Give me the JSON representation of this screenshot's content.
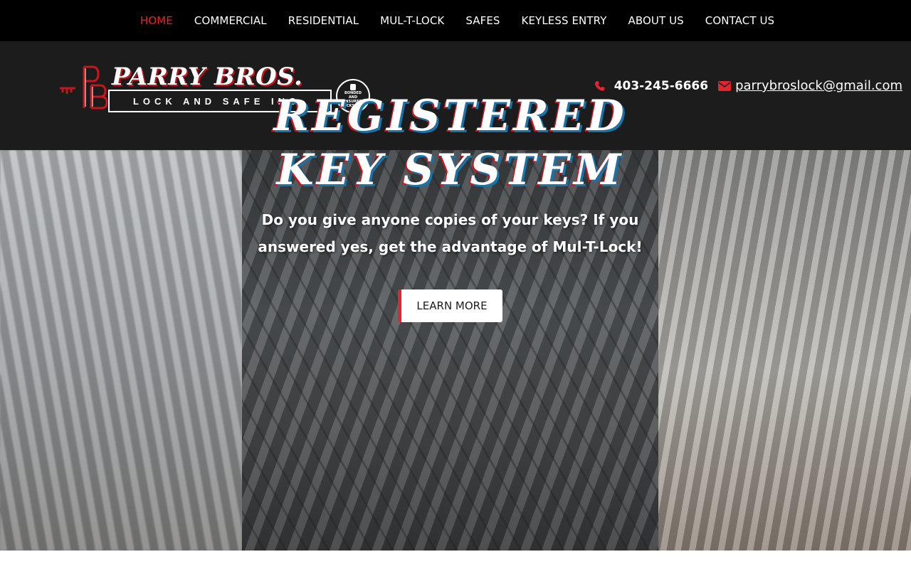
{
  "nav": {
    "items": [
      {
        "label": "HOME",
        "active": true
      },
      {
        "label": "COMMERCIAL",
        "active": false
      },
      {
        "label": "RESIDENTIAL",
        "active": false
      },
      {
        "label": "MUL-T-LOCK",
        "active": false
      },
      {
        "label": "SAFES",
        "active": false
      },
      {
        "label": "KEYLESS ENTRY",
        "active": false
      },
      {
        "label": "ABOUT US",
        "active": false
      },
      {
        "label": "CONTACT US",
        "active": false
      }
    ]
  },
  "header": {
    "logo": {
      "brand": "PARRY BROS.",
      "tagline": "LOCK AND SAFE INC.",
      "seal": [
        "BONDED",
        "AND",
        "INSURED",
        "LOCKSMITH"
      ]
    },
    "contact": {
      "phone": "403-245-6666",
      "email": "parrybroslock@gmail.com",
      "phone_icon": "phone-icon",
      "email_icon": "envelope-icon"
    }
  },
  "hero": {
    "title_line1": "REGISTERED",
    "title_line2": "KEY SYSTEM",
    "subtitle": "Do you give anyone copies of your keys? If you answered yes, get the advantage of Mul-T-Lock!",
    "button_label": "LEARN MORE"
  },
  "colors": {
    "accent": "#e1262d",
    "nav_bg": "#000000",
    "header_bg": "#1c1c1c"
  }
}
